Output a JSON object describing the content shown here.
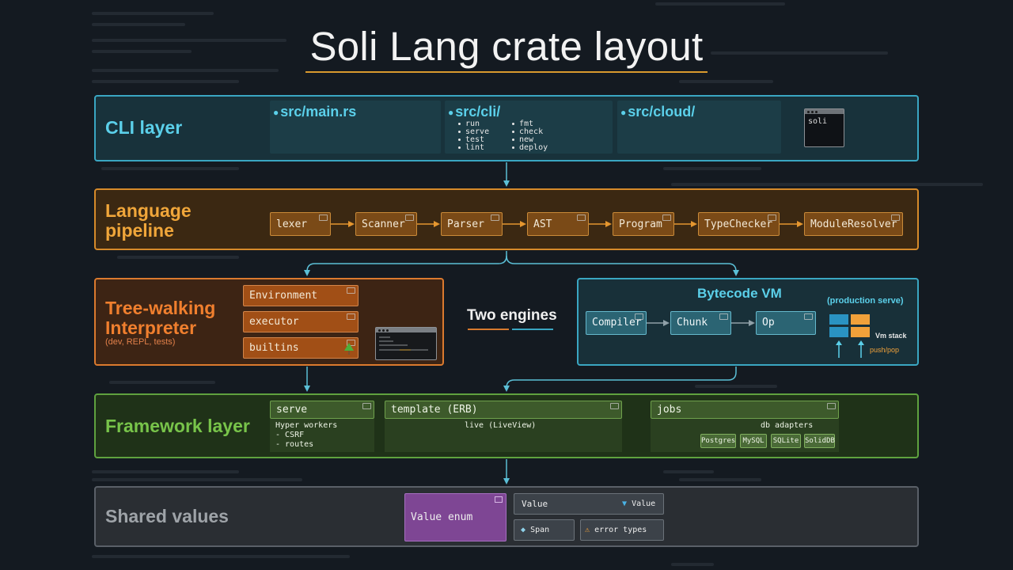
{
  "title": "Soli Lang crate layout",
  "cli": {
    "label": "CLI layer",
    "main_rs": "src/main.rs",
    "cli_dir": "src/cli/",
    "cloud_dir": "src/cloud/",
    "commands": [
      "run",
      "serve",
      "test",
      "lint",
      "fmt",
      "check",
      "new",
      "deploy"
    ],
    "terminal_text": "soli"
  },
  "pipeline": {
    "label_line1": "Language",
    "label_line2": "pipeline",
    "stages": [
      "lexer",
      "Scanner",
      "Parser",
      "AST",
      "Program",
      "TypeChecker",
      "ModuleResolver"
    ]
  },
  "tree": {
    "label_line1": "Tree-walking",
    "label_line2": "Interpreter",
    "sub": "(dev, REPL, tests)",
    "nodes": [
      "Environment",
      "executor",
      "builtins"
    ]
  },
  "two_engines": "Two engines",
  "vm": {
    "label": "Bytecode VM",
    "sub": "(production serve)",
    "nodes": [
      "Compiler",
      "Chunk",
      "Op"
    ],
    "stack_label": "Vm stack",
    "push_pop": "push/pop"
  },
  "framework": {
    "label": "Framework layer",
    "serve": "serve",
    "serve_items": [
      "Hyper workers",
      "- CSRF",
      "- routes"
    ],
    "template": "template (ERB)",
    "live": "live (LiveView)",
    "jobs": "jobs",
    "db_label": "db adapters",
    "dbs": [
      "Postgres",
      "MySQL",
      "SQLite",
      "SolidDB"
    ]
  },
  "shared": {
    "label": "Shared values",
    "value_enum": "Value enum",
    "value": "Value",
    "value_tag": "Value",
    "span": "Span",
    "error_types": "error types"
  },
  "colors": {
    "cli": "#3aa6c2",
    "pipeline": "#d68a2a",
    "tree": "#db7a2e",
    "vm": "#3aa6c2",
    "framework": "#5fa23f",
    "shared": "#5a6068",
    "value_enum": "#8a4fa3"
  }
}
